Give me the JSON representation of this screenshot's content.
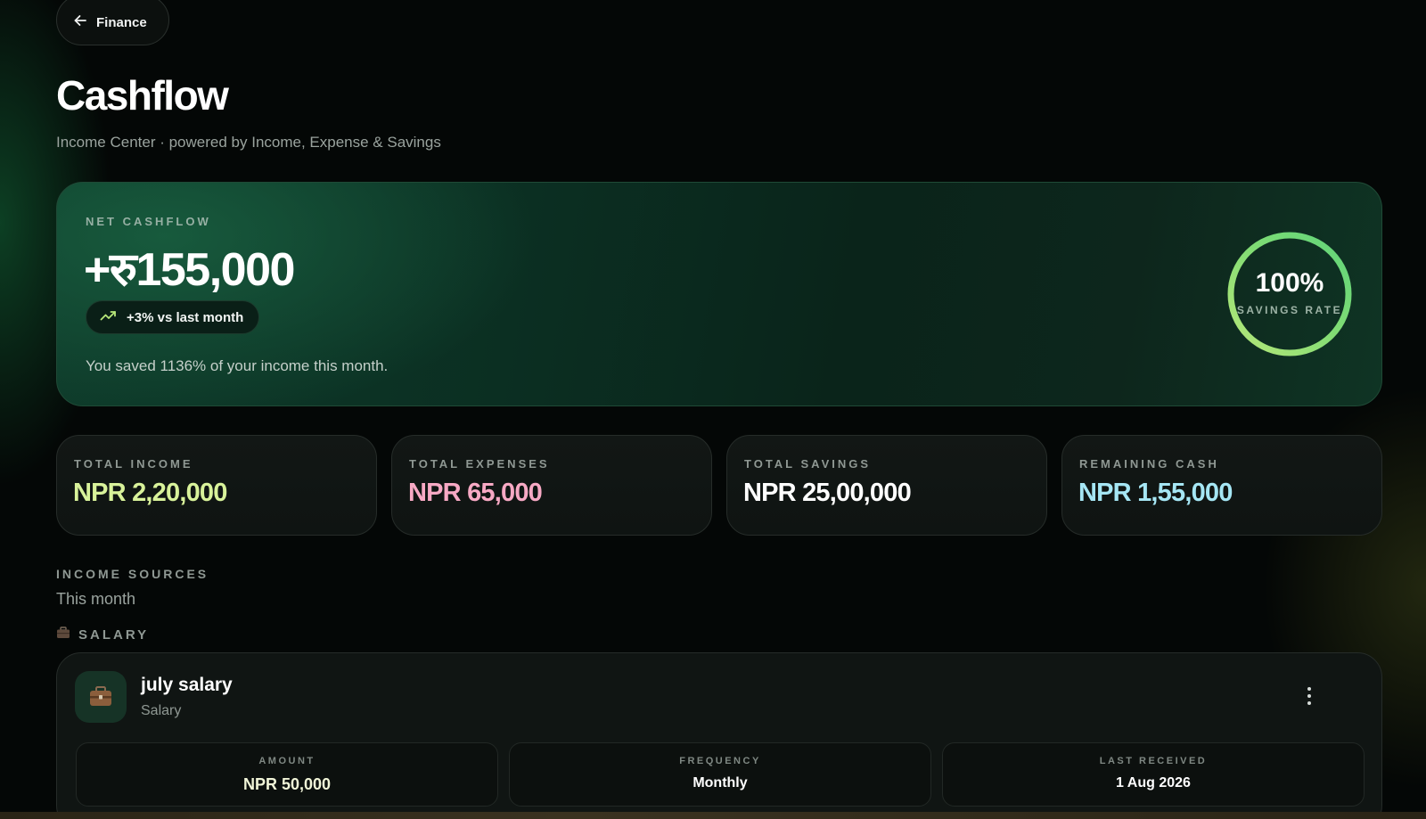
{
  "nav": {
    "back_label": "Finance"
  },
  "header": {
    "title": "Cashflow",
    "subtitle": "Income Center · powered by Income, Expense & Savings"
  },
  "hero": {
    "label": "NET CASHFLOW",
    "value": "+रु155,000",
    "trend": "+3% vs last month",
    "note": "You saved 1136% of your income this month.",
    "savings_rate_value": 100,
    "savings_rate_text": "100%",
    "savings_rate_label": "SAVINGS RATE"
  },
  "stats": [
    {
      "label": "TOTAL INCOME",
      "value": "NPR 2,20,000",
      "color": "#d8f29a"
    },
    {
      "label": "TOTAL EXPENSES",
      "value": "NPR 65,000",
      "color": "#f7a9c4"
    },
    {
      "label": "TOTAL SAVINGS",
      "value": "NPR 25,00,000",
      "color": "#ffffff"
    },
    {
      "label": "REMAINING CASH",
      "value": "NPR 1,55,000",
      "color": "#a5e6f4"
    }
  ],
  "sources": {
    "section_label": "INCOME SOURCES",
    "section_sub": "This month",
    "category": "SALARY",
    "items": [
      {
        "name": "july salary",
        "type": "Salary",
        "amount_label": "AMOUNT",
        "amount": "NPR 50,000",
        "frequency_label": "FREQUENCY",
        "frequency": "Monthly",
        "last_received_label": "LAST RECEIVED",
        "last_received": "1 Aug 2026"
      }
    ]
  },
  "colors": {
    "accent_green": "#6fe07a",
    "ring_light": "#b7e779",
    "positive": "#d8f29a",
    "negative": "#f7a9c4",
    "cash": "#a5e6f4"
  },
  "icons": [
    "arrow-left-icon",
    "trend-up-icon",
    "briefcase-icon",
    "more-vertical-icon"
  ]
}
